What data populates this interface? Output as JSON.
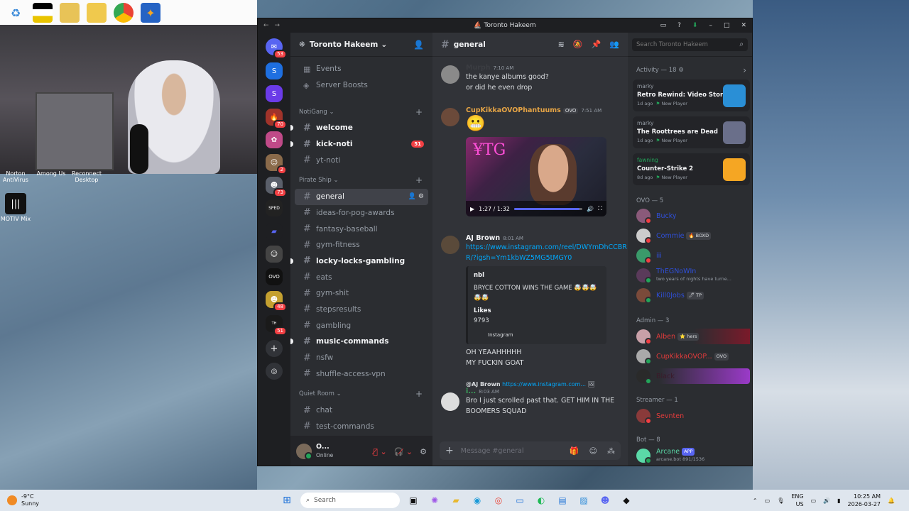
{
  "window": {
    "title": "Toronto Hakeem"
  },
  "desktop": {
    "icons": [
      {
        "label": "Norton AntiVirus"
      },
      {
        "label": "Among Us"
      },
      {
        "label": "Reconnect Desktop"
      },
      {
        "label": "MOTIV Mix"
      }
    ]
  },
  "guilds": {
    "home_badge": "53",
    "badges": [
      "70",
      "2",
      "73",
      "48",
      "51"
    ]
  },
  "server": {
    "name": "Toronto Hakeem",
    "top_items": [
      {
        "label": "Events"
      },
      {
        "label": "Server Boosts"
      }
    ],
    "categories": [
      {
        "name": "NotiGang",
        "channels": [
          {
            "name": "welcome",
            "unread": true
          },
          {
            "name": "kick-noti",
            "unread": true,
            "badge": "51"
          },
          {
            "name": "yt-noti"
          }
        ]
      },
      {
        "name": "Pirate Ship",
        "channels": [
          {
            "name": "general",
            "active": true
          },
          {
            "name": "ideas-for-pog-awards"
          },
          {
            "name": "fantasy-baseball"
          },
          {
            "name": "gym-fitness"
          },
          {
            "name": "locky-locks-gambling",
            "unread": true
          },
          {
            "name": "eats"
          },
          {
            "name": "gym-shit"
          },
          {
            "name": "stepsresults"
          },
          {
            "name": "gambling"
          },
          {
            "name": "music-commands",
            "unread": true
          },
          {
            "name": "nsfw"
          },
          {
            "name": "shuffle-access-vpn"
          }
        ]
      },
      {
        "name": "Quiet Room",
        "channels": [
          {
            "name": "chat"
          },
          {
            "name": "test-commands"
          }
        ]
      }
    ]
  },
  "user": {
    "name": "O...",
    "status": "Online"
  },
  "chat": {
    "channel": "general",
    "composer_placeholder": "Message #general",
    "messages": [
      {
        "author": "Murph",
        "time": "7:10 AM",
        "lines": [
          "the kanye albums good?",
          "or did he even drop"
        ]
      },
      {
        "author": "CupKikkaOVOPhantuums",
        "tag": "OVO",
        "time": "7:51 AM",
        "lines": [
          "😬"
        ],
        "video_time": "1:27 / 1:32",
        "video_progress": 0.95
      },
      {
        "author": "AJ Brown",
        "time": "8:01 AM",
        "link": "https://www.instagram.com/reel/DWYmDhCCBRR/?igsh=Ym1kbWZ5MG5tMGY0",
        "embed": {
          "author": "nbl",
          "text": "BRYCE COTTON WINS THE GAME 🤯🤯🤯🤯🤯",
          "field": "Likes",
          "value": "9793",
          "footer": "Instagram"
        },
        "after": [
          "OH YEAAHHHHH",
          "MY FUCKIN GOAT"
        ]
      },
      {
        "author": "i...",
        "time": "8:03 AM",
        "reply_to": "@AJ Brown",
        "reply_text": "https://www.instagram.com...",
        "lines": [
          "Bro I just scrolled past that. GET HIM IN THE BOOMERS SQUAD"
        ]
      }
    ]
  },
  "members": {
    "search_placeholder": "Search Toronto Hakeem",
    "activity_header": "Activity — 18",
    "activities": [
      {
        "user": "marky",
        "title": "Retro Rewind: Video Store ...",
        "ago": "1d ago",
        "badge": "New Player",
        "color": "#2a8fd6"
      },
      {
        "user": "marky",
        "title": "The Roottrees are Dead",
        "ago": "1d ago",
        "badge": "New Player",
        "color": "#6a6f8a"
      },
      {
        "user": "fawning",
        "title": "Counter-Strike 2",
        "ago": "8d ago",
        "badge": "New Player",
        "color": "#f5a623"
      }
    ],
    "groups": [
      {
        "label": "OVO — 5",
        "members": [
          {
            "name": "Bucky",
            "color": "#2f4fd8"
          },
          {
            "name": "Commie",
            "color": "#2f4fd8",
            "tag": "🔥 BOXD"
          },
          {
            "name": "iii",
            "color": "#2f4fd8"
          },
          {
            "name": "ThEGNoWIn",
            "color": "#2f4fd8",
            "sub": "two years of nights have turne..."
          },
          {
            "name": "Kill0Jobs",
            "color": "#2f4fd8",
            "tag": "🖊 TP"
          }
        ]
      },
      {
        "label": "Admin — 3",
        "members": [
          {
            "name": "Alben",
            "color": "#e53b3b",
            "tag": "⭐ hers"
          },
          {
            "name": "CupKikkaOVOP...",
            "color": "#e53b3b",
            "tag": "OVO"
          },
          {
            "name": "Black",
            "color": "#3b1a2a"
          }
        ]
      },
      {
        "label": "Streamer — 1",
        "members": [
          {
            "name": "Sevnten",
            "color": "#e53b3b"
          }
        ]
      },
      {
        "label": "Bot — 8",
        "members": [
          {
            "name": "Arcane",
            "color": "#5bd9a8",
            "tag": "APP",
            "sub": "arcane.bot 891/1536"
          }
        ]
      }
    ]
  },
  "taskbar": {
    "weather_temp": "-9°C",
    "weather_desc": "Sunny",
    "search": "Search",
    "lang": "ENG",
    "region": "US",
    "time": "10:25 AM",
    "date": "2026-03-27"
  }
}
